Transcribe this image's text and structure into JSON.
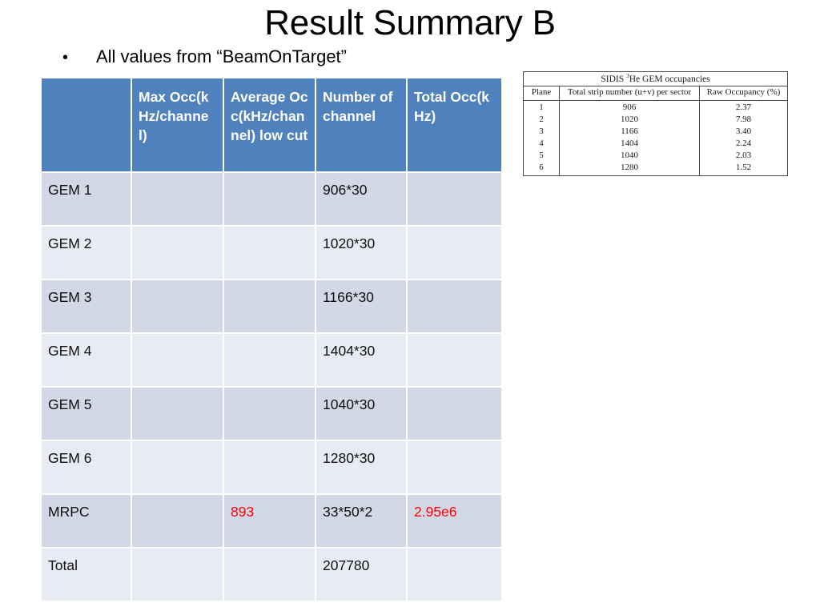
{
  "slide": {
    "title": "Result Summary B",
    "bullet_marker": "•",
    "bullet_text": "All values from “BeamOnTarget”"
  },
  "colors": {
    "header_blue": "#4F81BD",
    "band_dark": "#D2D8E6",
    "band_light": "#E8EBF3",
    "highlight_red": "#FF0000",
    "text": "#101010"
  },
  "main_table": {
    "headers": [
      "",
      "Max Occ(kHz/channel)",
      "Average Occ(kHz/channel) low cut",
      "Number of channel",
      "Total Occ(kHz)"
    ],
    "rows": [
      {
        "label": "GEM  1",
        "max_occ": "",
        "avg_occ": "",
        "num_channel": "906*30",
        "total_occ": ""
      },
      {
        "label": "GEM  2",
        "max_occ": "",
        "avg_occ": "",
        "num_channel": "1020*30",
        "total_occ": ""
      },
      {
        "label": "GEM  3",
        "max_occ": "",
        "avg_occ": "",
        "num_channel": "1166*30",
        "total_occ": ""
      },
      {
        "label": "GEM  4",
        "max_occ": "",
        "avg_occ": "",
        "num_channel": "1404*30",
        "total_occ": ""
      },
      {
        "label": "GEM  5",
        "max_occ": "",
        "avg_occ": "",
        "num_channel": "1040*30",
        "total_occ": ""
      },
      {
        "label": "GEM  6",
        "max_occ": "",
        "avg_occ": "",
        "num_channel": "1280*30",
        "total_occ": ""
      },
      {
        "label": "MRPC",
        "max_occ": "",
        "avg_occ": "893",
        "num_channel": "33*50*2",
        "total_occ": "2.95e6"
      },
      {
        "label": "Total",
        "max_occ": "",
        "avg_occ": "",
        "num_channel": "207780",
        "total_occ": ""
      }
    ]
  },
  "inset_table": {
    "caption_pre": "SIDIS ",
    "caption_sup": "3",
    "caption_post": "He GEM occupancies",
    "headers": [
      "Plane",
      "Total strip number (u+v) per sector",
      "Raw Occupancy (%)"
    ],
    "rows": [
      {
        "plane": "1",
        "strips": "906",
        "occupancy": "2.37"
      },
      {
        "plane": "2",
        "strips": "1020",
        "occupancy": "7.98"
      },
      {
        "plane": "3",
        "strips": "1166",
        "occupancy": "3.40"
      },
      {
        "plane": "4",
        "strips": "1404",
        "occupancy": "2.24"
      },
      {
        "plane": "5",
        "strips": "1040",
        "occupancy": "2.03"
      },
      {
        "plane": "6",
        "strips": "1280",
        "occupancy": "1.52"
      }
    ]
  }
}
